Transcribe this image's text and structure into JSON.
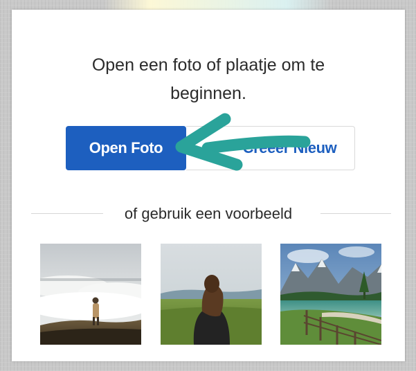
{
  "dialog": {
    "prompt_line1": "Open een foto of plaatje om te",
    "prompt_line2": "beginnen.",
    "open_photo_label": "Open Foto",
    "create_new_label": "Creëer Nieuw",
    "examples_label": "of gebruik een voorbeeld"
  },
  "examples": [
    {
      "name": "mountain-fog-hiker"
    },
    {
      "name": "woman-in-meadow"
    },
    {
      "name": "lake-with-fence"
    }
  ],
  "colors": {
    "primary": "#1d5fbf",
    "arrow": "#2aa39a"
  }
}
